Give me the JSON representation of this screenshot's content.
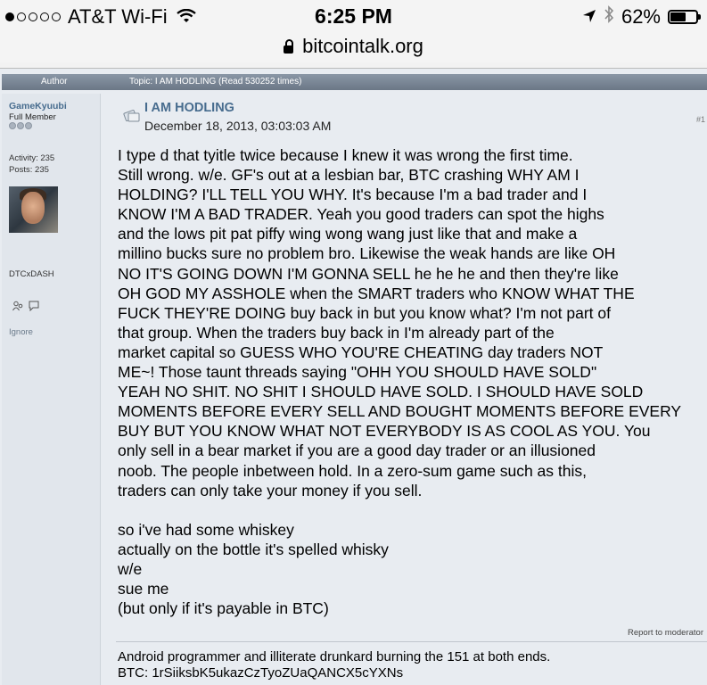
{
  "status_bar": {
    "carrier": "AT&T Wi-Fi",
    "time": "6:25 PM",
    "battery_percent": "62%",
    "battery_level": 0.62,
    "signal_dots_filled": 1,
    "signal_dots_total": 5
  },
  "url_bar": {
    "domain": "bitcointalk.org"
  },
  "header": {
    "author_label": "Author",
    "topic_label": "Topic: I AM HODLING  (Read 530252 times)"
  },
  "poster": {
    "name": "GameKyuubi",
    "rank": "Full Member",
    "activity": "Activity: 235",
    "posts": "Posts: 235",
    "signature_name": "DTCxDASH",
    "ignore": "Ignore"
  },
  "post": {
    "title": "I AM HODLING",
    "date": "December 18, 2013, 03:03:03 AM",
    "number": "#1",
    "body_lines": [
      "I type d that tyitle twice because I knew it was wrong the first time.",
      "Still wrong.  w/e.  GF's out at a lesbian bar, BTC crashing WHY AM I",
      "HOLDING? I'LL TELL YOU WHY.  It's because I'm a bad trader and I",
      "KNOW I'M A BAD TRADER.  Yeah you good traders can spot the highs",
      "and the lows pit pat piffy wing wong wang just like that and make a",
      "millino bucks sure no problem bro.  Likewise the weak hands are like OH",
      "NO IT'S GOING DOWN I'M GONNA SELL he he he and then they're like",
      "OH GOD MY ASSHOLE when the SMART traders who KNOW WHAT THE",
      "FUCK THEY'RE DOING buy back in but you know what?  I'm not part of",
      "that group.  When the traders buy back in I'm already part of the",
      "market capital so GUESS WHO YOU'RE CHEATING day traders NOT",
      "ME~!  Those taunt threads saying \"OHH YOU SHOULD HAVE SOLD\"",
      "YEAH NO SHIT.  NO SHIT I SHOULD HAVE SOLD.  I SHOULD HAVE SOLD",
      "MOMENTS BEFORE EVERY SELL AND BOUGHT MOMENTS BEFORE EVERY",
      "BUY BUT YOU KNOW WHAT NOT EVERYBODY IS AS COOL AS YOU.  You",
      "only sell in a bear market if you are a good day trader or an illusioned",
      "noob.  The people inbetween hold.  In a zero-sum game such as this,",
      "traders can only take your money if you sell."
    ],
    "body_lines_2": [
      "so i've had some whiskey",
      "actually on the bottle it's spelled whisky",
      "w/e",
      "sue me",
      "(but only if it's payable in BTC)"
    ],
    "report_label": "Report to moderator"
  },
  "signature": {
    "line1": "Android programmer and illiterate drunkard burning the 151 at both ends.",
    "line2": "BTC: 1rSiiksbK5ukazCzTyoZUaQANCX5cYXNs"
  },
  "icons": [
    "signal-dots-icon",
    "wifi-icon",
    "location-arrow-icon",
    "bluetooth-icon",
    "battery-icon",
    "lock-icon",
    "topic-icon",
    "profile-icon",
    "message-icon"
  ]
}
